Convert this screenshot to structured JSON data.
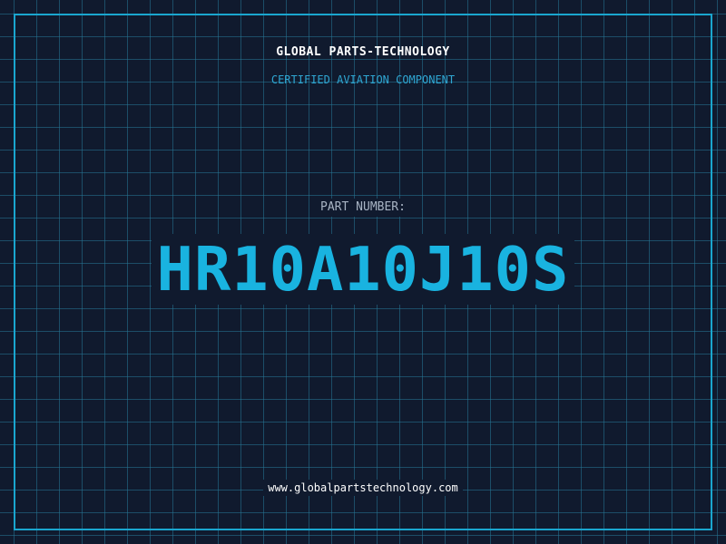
{
  "header": {
    "company": "GLOBAL PARTS-TECHNOLOGY",
    "subtitle": "CERTIFIED AVIATION COMPONENT"
  },
  "part": {
    "label": "PART NUMBER:",
    "number": "HR10A10J10S"
  },
  "footer": {
    "url": "www.globalpartstechnology.com"
  },
  "colors": {
    "background": "#101a2e",
    "grid": "#267696",
    "accent": "#19b3e0",
    "subtitle": "#2fa6d2",
    "label": "#a8b4c4",
    "text": "#ffffff"
  }
}
